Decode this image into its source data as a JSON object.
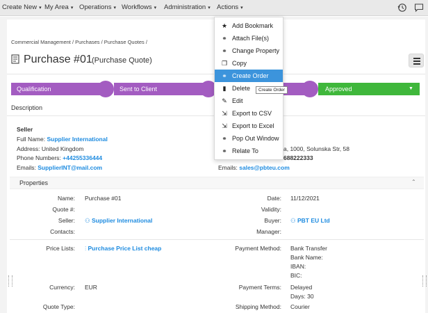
{
  "nav": {
    "items": [
      {
        "label": "Create New"
      },
      {
        "label": "My Area"
      },
      {
        "label": "Operations"
      },
      {
        "label": "Workflows"
      },
      {
        "label": "Administration"
      },
      {
        "label": "Actions"
      }
    ],
    "caret": "▾"
  },
  "breadcrumb": "Commercial Management / Purchases / Purchase Quotes /",
  "title": "Purchase #01",
  "subtitle": "(Purchase Quote)",
  "pipeline": {
    "stages": [
      "Qualification",
      "Sent to Client",
      "",
      "Approved"
    ]
  },
  "description_label": "Description",
  "seller": {
    "heading": "Seller",
    "full_name_label": "Full Name:",
    "full_name": "Supplier International",
    "address_label": "Address:",
    "address": "United Kingdom",
    "phone_label": "Phone Numbers:",
    "phone": "+44255336444",
    "email_label": "Emails:",
    "email": "SupplierINT@mail.com"
  },
  "buyer": {
    "address_partial": "a, 1000, Solunska Str, 58",
    "phone_partial": "688222333",
    "email_label": "Emails:",
    "email": "sales@pbteu.com"
  },
  "properties": {
    "header": "Properties",
    "left": [
      {
        "label": "Name:",
        "value": ""
      },
      {
        "label": "Quote #:",
        "value": ""
      },
      {
        "label": "Seller:",
        "value": ""
      },
      {
        "label": "Contacts:",
        "value": ""
      }
    ],
    "name_value": "Purchase #01",
    "seller_value": "Supplier International",
    "right": [
      {
        "label": "Date:"
      },
      {
        "label": "Validity:"
      },
      {
        "label": "Buyer:"
      },
      {
        "label": "Manager:"
      }
    ],
    "date_value": "11/12/2021",
    "buyer_value": "PBT EU Ltd",
    "price_lists_label": "Price Lists:",
    "price_list_value": "Purchase Price List cheap",
    "payment_method_label": "Payment Method:",
    "payment_method_lines": [
      "Bank Transfer",
      "Bank Name:",
      "IBAN:",
      "BIC:"
    ],
    "currency_label": "Currency:",
    "currency_value": "EUR",
    "payment_terms_label": "Payment Terms:",
    "payment_terms_lines": [
      "Delayed",
      "Days: 30"
    ],
    "quote_type_label": "Quote Type:",
    "shipping_method_label": "Shipping Method:",
    "shipping_method_value": "Courier"
  },
  "actions_menu": {
    "items": [
      {
        "label": "Add Bookmark",
        "icon": "star-icon",
        "glyph": "★"
      },
      {
        "label": "Attach File(s)",
        "icon": "attach-icon",
        "glyph": "⚭"
      },
      {
        "label": "Change Property",
        "icon": "property-icon",
        "glyph": "⚭"
      },
      {
        "label": "Copy",
        "icon": "copy-icon",
        "glyph": "❐"
      },
      {
        "label": "Create Order",
        "icon": "order-icon",
        "glyph": "⚭"
      },
      {
        "label": "Delete",
        "icon": "trash-icon",
        "glyph": "▮"
      },
      {
        "label": "Edit",
        "icon": "pencil-icon",
        "glyph": "✎"
      },
      {
        "label": "Export to CSV",
        "icon": "export-icon",
        "glyph": "⇲"
      },
      {
        "label": "Export to Excel",
        "icon": "export-icon",
        "glyph": "⇲"
      },
      {
        "label": "Pop Out Window",
        "icon": "popout-icon",
        "glyph": "⚭"
      },
      {
        "label": "Relate To",
        "icon": "relate-icon",
        "glyph": "⚭"
      }
    ],
    "highlighted_index": 4,
    "tooltip": "Create Order"
  },
  "colors": {
    "stage_purple": "#a35cc1",
    "stage_green": "#3fb73b",
    "link": "#1d8be0",
    "menu_highlight": "#3c94dc"
  }
}
